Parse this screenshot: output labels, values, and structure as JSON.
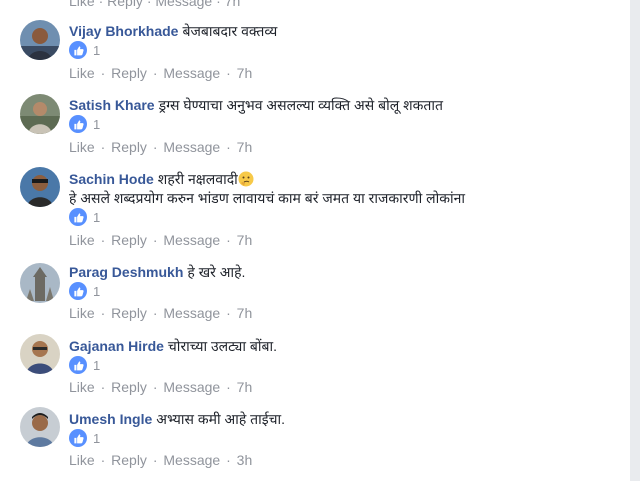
{
  "top_actions": {
    "like": "Like",
    "reply": "Reply",
    "message": "Message",
    "time": "7h"
  },
  "comments": [
    {
      "author": "Vijay Bhorkhade",
      "text": "बेजबाबदार वक्तव्य",
      "text2": "",
      "reactions": "1",
      "actions": {
        "like": "Like",
        "reply": "Reply",
        "message": "Message",
        "time": "7h"
      }
    },
    {
      "author": "Satish Khare",
      "text": "ड्रग्स घेण्याचा अनुभव असलल्या व्यक्ति असे बोलू शकतात",
      "text2": "",
      "reactions": "1",
      "actions": {
        "like": "Like",
        "reply": "Reply",
        "message": "Message",
        "time": "7h"
      }
    },
    {
      "author": "Sachin Hode",
      "text": "शहरी नक्षलवादी",
      "text2": "हे असले शब्दप्रयोग करुन भांडण लावायचं काम बरं जमत या राजकारणी लोकांना",
      "reactions": "1",
      "emoji": "thinking-face-emoji",
      "actions": {
        "like": "Like",
        "reply": "Reply",
        "message": "Message",
        "time": "7h"
      }
    },
    {
      "author": "Parag Deshmukh",
      "text": "हे खरे आहे.",
      "text2": "",
      "reactions": "1",
      "actions": {
        "like": "Like",
        "reply": "Reply",
        "message": "Message",
        "time": "7h"
      }
    },
    {
      "author": "Gajanan Hirde",
      "text": "चोराच्या उलट्या बोंबा.",
      "text2": "",
      "reactions": "1",
      "actions": {
        "like": "Like",
        "reply": "Reply",
        "message": "Message",
        "time": "7h"
      }
    },
    {
      "author": "Umesh Ingle",
      "text": "अभ्यास कमी आहे ताईचा.",
      "text2": "",
      "reactions": "1",
      "actions": {
        "like": "Like",
        "reply": "Reply",
        "message": "Message",
        "time": "3h"
      }
    }
  ],
  "colors": {
    "author": "#385898",
    "meta": "#90949c",
    "like_badge": "#5890ff",
    "text": "#1d2129"
  }
}
